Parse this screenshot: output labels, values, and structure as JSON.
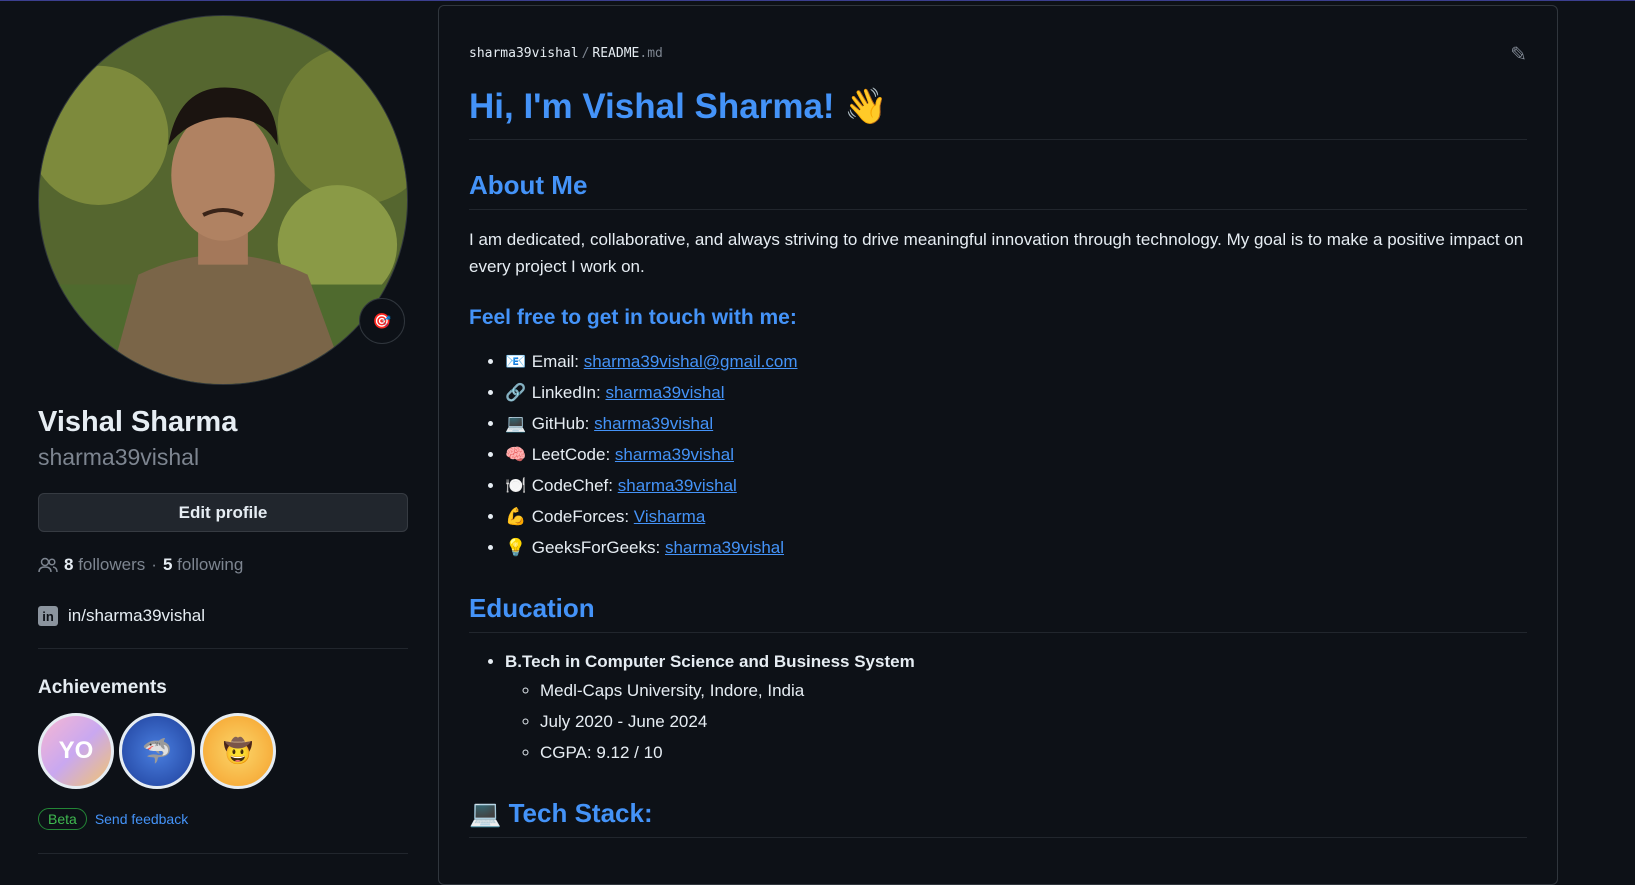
{
  "sidebar": {
    "name": "Vishal Sharma",
    "login": "sharma39vishal",
    "edit_label": "Edit profile",
    "followers_count": "8",
    "followers_label": "followers",
    "sep": "·",
    "following_count": "5",
    "following_label": "following",
    "linkedin_text": "in/sharma39vishal",
    "linkedin_icon": "in",
    "status_emoji": "🎯",
    "achievements_title": "Achievements",
    "badges": [
      "YOLO",
      "Pull Shark",
      "Quickdraw"
    ],
    "beta_label": "Beta",
    "feedback_label": "Send feedback"
  },
  "readme": {
    "crumb_user": "sharma39vishal",
    "crumb_sep": "/",
    "crumb_file": "README",
    "crumb_ext": ".md",
    "edit_icon": "✎",
    "h1": "Hi, I'm Vishal Sharma! 👋",
    "about_heading": "About Me",
    "about_text": "I am dedicated, collaborative, and always striving to drive meaningful innovation through technology. My goal is to make a positive impact on every project I work on.",
    "contact_heading": "Feel free to get in touch with me:",
    "contacts": [
      {
        "emoji": "📧",
        "label": "Email:",
        "value": "sharma39vishal@gmail.com"
      },
      {
        "emoji": "🔗",
        "label": "LinkedIn:",
        "value": "sharma39vishal"
      },
      {
        "emoji": "💻",
        "label": "GitHub:",
        "value": "sharma39vishal"
      },
      {
        "emoji": "🧠",
        "label": "LeetCode:",
        "value": "sharma39vishal"
      },
      {
        "emoji": "🍽️",
        "label": "CodeChef:",
        "value": "sharma39vishal"
      },
      {
        "emoji": "💪",
        "label": "CodeForces:",
        "value": "Visharma"
      },
      {
        "emoji": "💡",
        "label": "GeeksForGeeks:",
        "value": "sharma39vishal"
      }
    ],
    "education_heading": "Education",
    "education": {
      "degree": "B.Tech in Computer Science and Business System",
      "details": [
        "Medl-Caps University, Indore, India",
        "July 2020 - June 2024",
        "CGPA: 9.12 / 10"
      ]
    },
    "tech_heading": "💻 Tech Stack:"
  }
}
